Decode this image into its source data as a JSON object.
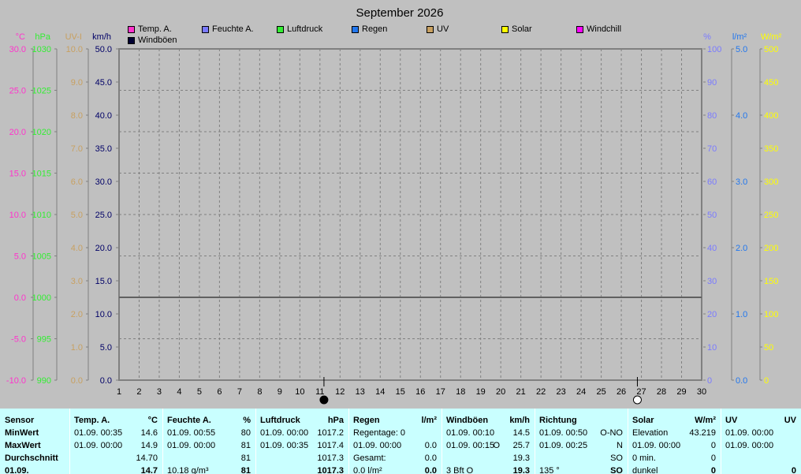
{
  "title": "September 2026",
  "legend": [
    {
      "name": "Temp. A.",
      "color": "#ff33cc"
    },
    {
      "name": "Feuchte A.",
      "color": "#7a7aff"
    },
    {
      "name": "Luftdruck",
      "color": "#33ee33"
    },
    {
      "name": "Regen",
      "color": "#2277ee"
    },
    {
      "name": "UV",
      "color": "#c8a060"
    },
    {
      "name": "Solar",
      "color": "#ffff00"
    },
    {
      "name": "Windchill",
      "color": "#ff00ff"
    },
    {
      "name": "Windböen",
      "color": "#000033"
    }
  ],
  "axes": {
    "left": [
      {
        "unit": "°C",
        "color": "#ff33cc",
        "ticks": [
          "30.0",
          "25.0",
          "20.0",
          "15.0",
          "10.0",
          "5.0",
          "0.0",
          "-5.0",
          "-10.0"
        ]
      },
      {
        "unit": "hPa",
        "color": "#33ee33",
        "ticks": [
          "1030",
          "1025",
          "1020",
          "1015",
          "1010",
          "1005",
          "1000",
          "995",
          "990"
        ]
      },
      {
        "unit": "UV-I",
        "color": "#c8a060",
        "ticks": [
          "10.0",
          "9.0",
          "8.0",
          "7.0",
          "6.0",
          "5.0",
          "4.0",
          "3.0",
          "2.0",
          "1.0",
          "0.0"
        ]
      },
      {
        "unit": "km/h",
        "color": "#000066",
        "ticks": [
          "50.0",
          "45.0",
          "40.0",
          "35.0",
          "30.0",
          "25.0",
          "20.0",
          "15.0",
          "10.0",
          "5.0",
          "0.0"
        ]
      }
    ],
    "right": [
      {
        "unit": "%",
        "color": "#7a7aff",
        "ticks": [
          "100",
          "90",
          "80",
          "70",
          "60",
          "50",
          "40",
          "30",
          "20",
          "10",
          "0"
        ]
      },
      {
        "unit": "l/m²",
        "color": "#2277ee",
        "ticks": [
          "5.0",
          "4.0",
          "3.0",
          "2.0",
          "1.0",
          "0.0"
        ]
      },
      {
        "unit": "W/m²",
        "color": "#ffff00",
        "ticks": [
          "500",
          "450",
          "400",
          "350",
          "300",
          "250",
          "200",
          "150",
          "100",
          "50",
          "0"
        ]
      }
    ],
    "x_ticks": [
      "1",
      "2",
      "3",
      "4",
      "5",
      "6",
      "7",
      "8",
      "9",
      "10",
      "11",
      "12",
      "13",
      "14",
      "15",
      "16",
      "17",
      "18",
      "19",
      "20",
      "21",
      "22",
      "23",
      "24",
      "25",
      "26",
      "27",
      "28",
      "29",
      "30"
    ]
  },
  "chart_data": {
    "type": "line",
    "title": "September 2026",
    "x": [
      1,
      30
    ],
    "xlim": [
      1,
      30
    ],
    "series": [
      {
        "name": "Windböen",
        "unit": "km/h",
        "values": [
          12.5,
          12.5
        ]
      }
    ],
    "ylim_kmh": [
      0,
      50
    ],
    "grid": true,
    "markers": [
      {
        "day": 11.2,
        "symbol": "filled-circle"
      },
      {
        "day": 26.8,
        "symbol": "open-circle"
      }
    ]
  },
  "table": [
    {
      "header": "Sensor",
      "unit": "",
      "rows": [
        [
          "MinWert",
          "",
          ""
        ],
        [
          "MaxWert",
          "",
          ""
        ],
        [
          "Durchschnitt",
          "",
          ""
        ],
        [
          "01.09.",
          "",
          ""
        ]
      ]
    },
    {
      "header": "Temp. A.",
      "unit": "°C",
      "rows": [
        [
          "01.09.  00:35",
          "",
          "14.6"
        ],
        [
          "01.09.  00:00",
          "",
          "14.9"
        ],
        [
          "",
          "",
          "14.70"
        ],
        [
          "",
          "",
          "14.7"
        ]
      ]
    },
    {
      "header": "Feuchte A.",
      "unit": "%",
      "rows": [
        [
          "01.09.  00:55",
          "",
          "80"
        ],
        [
          "01.09.  00:00",
          "",
          "81"
        ],
        [
          "",
          "",
          "81"
        ],
        [
          "10.18 g/m³",
          "",
          "81"
        ]
      ]
    },
    {
      "header": "Luftdruck",
      "unit": "hPa",
      "rows": [
        [
          "01.09.  00:00",
          "",
          "1017.2"
        ],
        [
          "01.09.  00:35",
          "",
          "1017.4"
        ],
        [
          "",
          "",
          "1017.3"
        ],
        [
          "",
          "",
          "1017.3"
        ]
      ]
    },
    {
      "header": "Regen",
      "unit": "l/m²",
      "rows": [
        [
          "Regentage: 0",
          "",
          ""
        ],
        [
          "01.09.  00:00",
          "",
          "0.0"
        ],
        [
          "Gesamt:",
          "",
          "0.0"
        ],
        [
          "0.0 l/m²",
          "",
          "0.0"
        ]
      ]
    },
    {
      "header": "Windböen",
      "unit": "km/h",
      "rows": [
        [
          "01.09.  00:10",
          "",
          "14.5"
        ],
        [
          "01.09.  00:15",
          "O",
          "25.7"
        ],
        [
          "",
          "",
          "19.3"
        ],
        [
          "3 Bft O",
          "",
          "19.3"
        ]
      ]
    },
    {
      "header": "Richtung",
      "unit": "",
      "rows": [
        [
          "01.09.  00:50",
          "",
          "O-NO"
        ],
        [
          "01.09.  00:25",
          "",
          "N"
        ],
        [
          "",
          "",
          "SO"
        ],
        [
          "135 °",
          "",
          "SO"
        ]
      ]
    },
    {
      "header": "Solar",
      "unit": "W/m²",
      "rows": [
        [
          "Elevation",
          "",
          "43.219"
        ],
        [
          "01.09.  00:00",
          "",
          "0"
        ],
        [
          "0 min.",
          "",
          "0"
        ],
        [
          "dunkel",
          "",
          "0"
        ]
      ]
    },
    {
      "header": "UV",
      "unit": "UV",
      "rows": [
        [
          "01.09.  00:00",
          "",
          ""
        ],
        [
          "01.09.  00:00",
          "",
          ""
        ],
        [
          "",
          "",
          ""
        ],
        [
          "",
          "",
          "0"
        ]
      ]
    }
  ]
}
